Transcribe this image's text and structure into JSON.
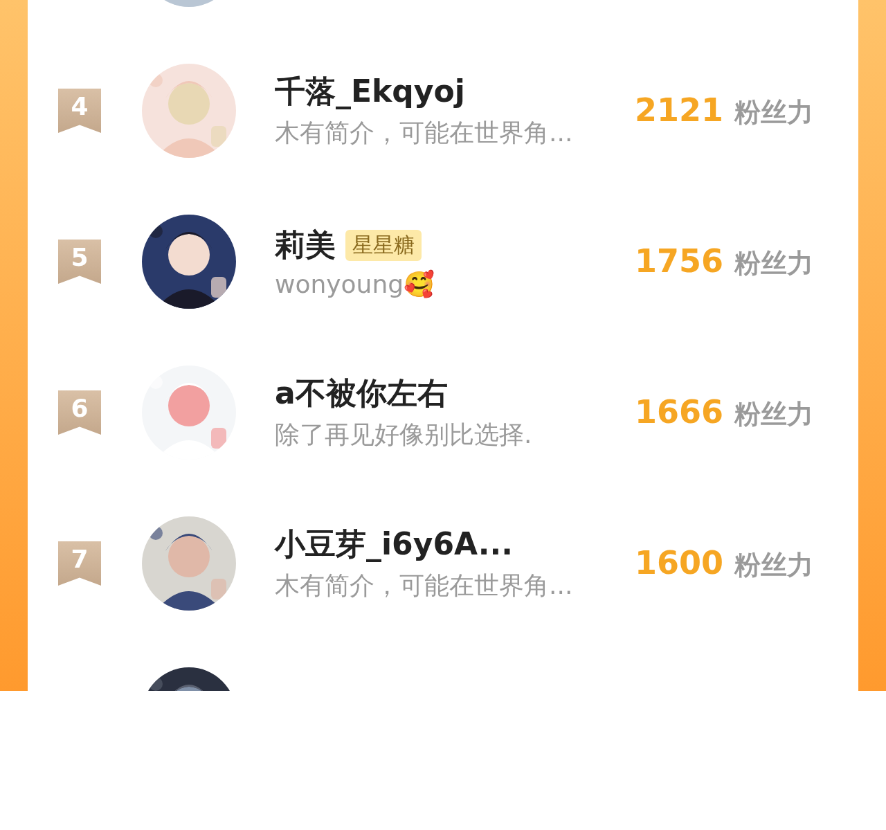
{
  "leaderboard": {
    "rows": [
      {
        "kind": "cut"
      },
      {
        "kind": "full",
        "rank": "4",
        "name": "千落_Ekqyoj",
        "bio": "木有简介，可能在世界角...",
        "score": "2121",
        "unit": "粉丝力"
      },
      {
        "kind": "full",
        "rank": "5",
        "name": "莉美",
        "tag": "星星糖",
        "bio": "wonyoung🥰",
        "score": "1756",
        "unit": "粉丝力"
      },
      {
        "kind": "full",
        "rank": "6",
        "name": "a不被你左右",
        "bio": "除了再见好像别比选择.",
        "score": "1666",
        "unit": "粉丝力"
      },
      {
        "kind": "full",
        "rank": "7",
        "name": "小豆芽_i6y6A...",
        "bio": "木有简介，可能在世界角...",
        "score": "1600",
        "unit": "粉丝力"
      },
      {
        "kind": "cut"
      }
    ]
  }
}
